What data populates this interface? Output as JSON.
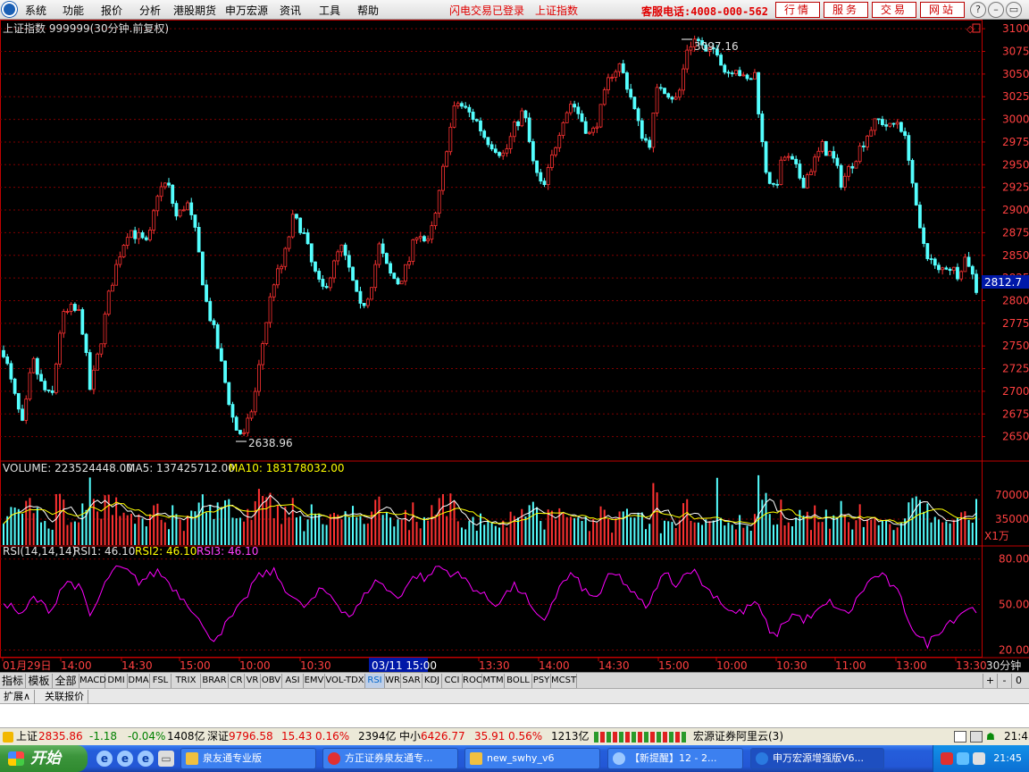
{
  "menu": {
    "items": [
      "系统",
      "功能",
      "报价",
      "分析",
      "港股期货",
      "申万宏源",
      "资讯",
      "工具",
      "帮助"
    ],
    "status_flash": "闪电交易已登录",
    "status_index": "上证指数",
    "phone": "客服电话:4008-000-562",
    "buttons": [
      "行情",
      "服务",
      "交易",
      "网站"
    ],
    "window_controls": [
      "?",
      "–",
      "▭",
      "×"
    ]
  },
  "chart": {
    "title": "上证指数  999999(30分钟.前复权)",
    "high_label": "3097.16",
    "low_label": "2638.96",
    "current_price": "2812.7",
    "price_axis": [
      "3100",
      "3075",
      "3050",
      "3025",
      "3000",
      "2975",
      "2950",
      "2925",
      "2900",
      "2875",
      "2850",
      "2825",
      "2800",
      "2775",
      "2750",
      "2725",
      "2700",
      "2675",
      "2650"
    ],
    "volume_title": "VOLUME: 223524448.00",
    "ma5_label": "MA5: 137425712.00",
    "ma10_label": "MA10: 183178032.00",
    "volume_axis": [
      "70000",
      "35000"
    ],
    "volume_unit": "X1万",
    "rsi_title": "RSI(14,14,14)",
    "rsi1_label": "RSI1: 46.10",
    "rsi2_label": "RSI2: 46.10",
    "rsi3_label": "RSI3: 46.10",
    "rsi_axis": [
      "80.00",
      "50.00",
      "20.00"
    ],
    "time_axis": [
      "01月29日",
      "14:00",
      "14:30",
      "15:00",
      "10:00",
      "10:30",
      "13:00",
      "13:30",
      "14:00",
      "14:30",
      "15:00",
      "10:00",
      "10:30",
      "11:00",
      "13:00",
      "13:30"
    ],
    "time_cursor": "03/11 15:00",
    "period": "30分钟",
    "colors": {
      "up": "#ff3232",
      "down": "#54ffff",
      "ma5": "#ffffff",
      "ma10": "#ffff00",
      "rsi": "#ff00ff",
      "grid": "#800000",
      "frame": "#c00000",
      "axis_text": "#ff4040"
    }
  },
  "chart_data": {
    "type": "candlestick",
    "title": "上证指数  999999(30分钟.前复权)",
    "ylim": [
      2625,
      3110
    ],
    "high": 3097.16,
    "low": 2638.96,
    "last": 2812.7,
    "close_trend": [
      2745,
      2700,
      2660,
      2735,
      2705,
      2690,
      2780,
      2790,
      2785,
      2700,
      2750,
      2810,
      2850,
      2880,
      2870,
      2860,
      2920,
      2930,
      2890,
      2910,
      2870,
      2800,
      2760,
      2710,
      2660,
      2650,
      2690,
      2760,
      2820,
      2840,
      2890,
      2880,
      2840,
      2810,
      2830,
      2860,
      2830,
      2790,
      2810,
      2860,
      2830,
      2820,
      2840,
      2880,
      2860,
      2900,
      2970,
      3020,
      3010,
      3000,
      2980,
      2970,
      2960,
      2990,
      3010,
      2950,
      2920,
      2960,
      3000,
      3020,
      3000,
      2980,
      3010,
      3050,
      3060,
      3030,
      2990,
      2970,
      3040,
      3030,
      3020,
      3080,
      3090,
      3070,
      3080,
      3050,
      3060,
      3040,
      3050,
      2950,
      2920,
      2960,
      2950,
      2930,
      2950,
      2970,
      2960,
      2930,
      2950,
      2970,
      2990,
      3000,
      2990,
      3000,
      2960,
      2880,
      2850,
      2830,
      2840,
      2830,
      2850,
      2812.7
    ],
    "volume_axis_ticks": [
      70000,
      35000
    ],
    "volume_unit": "X1万",
    "rsi_trend": [
      52,
      48,
      42,
      55,
      50,
      46,
      62,
      65,
      60,
      42,
      55,
      70,
      74,
      71,
      65,
      68,
      72,
      66,
      58,
      52,
      44,
      30,
      28,
      36,
      44,
      52,
      66,
      70,
      72,
      63,
      55,
      48,
      52,
      60,
      56,
      48,
      42,
      50,
      62,
      66,
      58,
      55,
      64,
      70,
      66,
      76,
      72,
      70,
      66,
      60,
      55,
      50,
      56,
      62,
      58,
      44,
      38,
      52,
      64,
      70,
      62,
      54,
      58,
      70,
      68,
      60,
      52,
      48,
      66,
      70,
      62,
      74,
      70,
      60,
      56,
      48,
      44,
      46,
      52,
      40,
      28,
      38,
      44,
      40,
      42,
      48,
      52,
      44,
      46,
      58,
      66,
      70,
      64,
      56,
      40,
      28,
      24,
      32,
      38,
      42,
      48,
      46.1
    ],
    "rsi_ylim": [
      15,
      88
    ],
    "rsi_ticks": [
      80,
      50,
      20
    ]
  },
  "indicator_tabs": [
    "指标",
    "模板",
    "全部",
    "MACD",
    "DMI",
    "DMA",
    "FSL",
    "TRIX",
    "BRAR",
    "CR",
    "VR",
    "OBV",
    "ASI",
    "EMV",
    "VOL-TDX",
    "RSI",
    "WR",
    "SAR",
    "KDJ",
    "CCI",
    "ROC",
    "MTM",
    "BOLL",
    "PSY",
    "MCST"
  ],
  "active_indicator": "RSI",
  "indicator_controls": [
    "+",
    "-",
    "0"
  ],
  "ext_tabs": [
    "扩展∧",
    "关联报价"
  ],
  "status": {
    "sh_label": "上证",
    "sh_value": "2835.86",
    "sh_change": "-1.18",
    "sh_pct": "-0.04%",
    "sh_amount": "1408亿",
    "sz_label": "深证",
    "sz_value": "9796.58",
    "sz_change": "15.43",
    "sz_pct": "0.16%",
    "sz_amount": "2394亿",
    "zx_label": "中小",
    "zx_value": "6426.77",
    "zx_change": "35.91",
    "zx_pct": "0.56%",
    "zx_amount": "1213亿",
    "server": "宏源证券阿里云(3)"
  },
  "taskbar": {
    "start_label": "开始",
    "tasks": [
      "泉友通专业版",
      "方正证券泉友通专...",
      "new_swhy_v6",
      "【新提醒】12 - 2...",
      "申万宏源增强版V6..."
    ],
    "clock": "21:45"
  }
}
